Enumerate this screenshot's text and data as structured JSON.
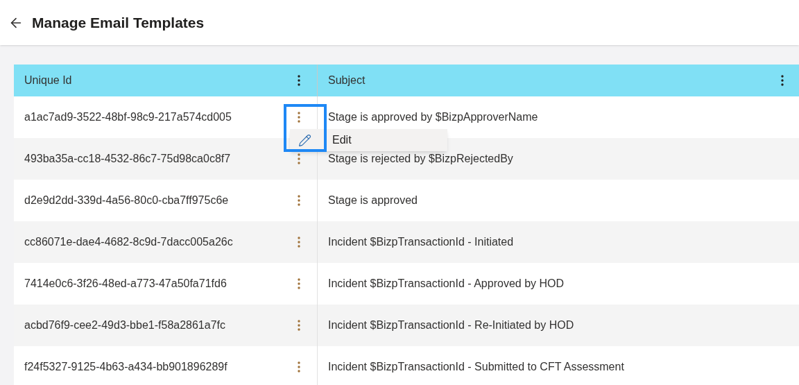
{
  "header": {
    "title": "Manage Email Templates"
  },
  "table": {
    "columns": [
      "Unique Id",
      "Subject"
    ],
    "rows": [
      {
        "id": "a1ac7ad9-3522-48bf-98c9-217a574cd005",
        "subject": "Stage is approved by $BizpApproverName",
        "menu_open": true
      },
      {
        "id": "493ba35a-cc18-4532-86c7-75d98ca0c8f7",
        "subject": "Stage is rejected by $BizpRejectedBy",
        "menu_open": false
      },
      {
        "id": "d2e9d2dd-339d-4a56-80c0-cba7ff975c6e",
        "subject": "Stage is approved",
        "menu_open": false
      },
      {
        "id": "cc86071e-dae4-4682-8c9d-7dacc005a26c",
        "subject": "Incident $BizpTransactionId - Initiated",
        "menu_open": false
      },
      {
        "id": "7414e0c6-3f26-48ed-a773-47a50fa71fd6",
        "subject": "Incident $BizpTransactionId - Approved by HOD",
        "menu_open": false
      },
      {
        "id": "acbd76f9-cee2-49d3-bbe1-f58a2861a7fc",
        "subject": "Incident $BizpTransactionId - Re-Initiated by HOD",
        "menu_open": false
      },
      {
        "id": "f24f5327-9125-4b63-a434-bb901896289f",
        "subject": "Incident $BizpTransactionId - Submitted to CFT Assessment",
        "menu_open": false
      }
    ]
  },
  "context_menu": {
    "items": [
      {
        "label": "Edit"
      }
    ]
  }
}
